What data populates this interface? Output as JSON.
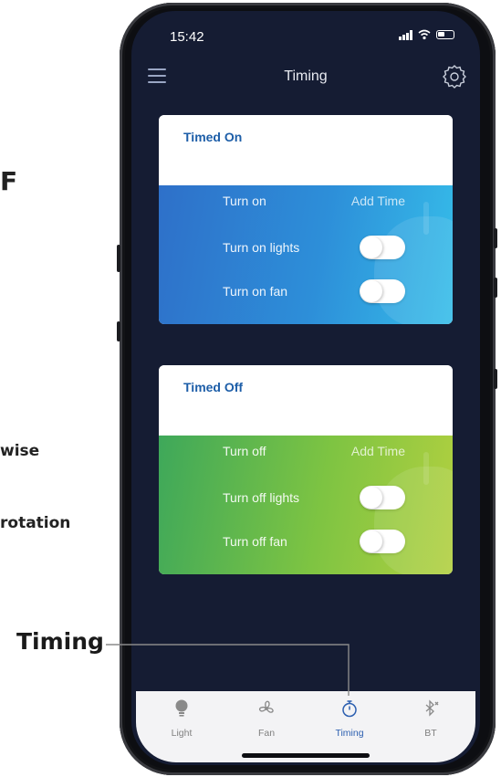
{
  "side_text": {
    "fragment_1": "F",
    "fragment_2": "wise",
    "fragment_3": "rotation",
    "callout": "Timing"
  },
  "status_bar": {
    "time": "15:42",
    "icons": [
      "signal-icon",
      "wifi-icon",
      "battery-icon"
    ]
  },
  "header": {
    "title": "Timing",
    "left_icon": "menu-icon",
    "right_icon": "settings-icon"
  },
  "cards": [
    {
      "title": "Timed On",
      "action_label": "Turn on",
      "add_time": "Add Time",
      "toggles": [
        {
          "label": "Turn on lights",
          "state": "off"
        },
        {
          "label": "Turn on fan",
          "state": "off"
        }
      ],
      "color": "#2e7fd0"
    },
    {
      "title": "Timed Off",
      "action_label": "Turn off",
      "add_time": "Add Time",
      "toggles": [
        {
          "label": "Turn off lights",
          "state": "off"
        },
        {
          "label": "Turn off fan",
          "state": "off"
        }
      ],
      "color": "#7cc142"
    }
  ],
  "tabs": [
    {
      "label": "Light",
      "icon": "bulb-icon",
      "active": false
    },
    {
      "label": "Fan",
      "icon": "fan-icon",
      "active": false
    },
    {
      "label": "Timing",
      "icon": "timer-icon",
      "active": true
    },
    {
      "label": "BT",
      "icon": "bluetooth-icon",
      "active": false
    }
  ],
  "colors": {
    "accent": "#2c5fb0",
    "screen_bg": "#151c33",
    "card_title": "#1d5ea8"
  }
}
